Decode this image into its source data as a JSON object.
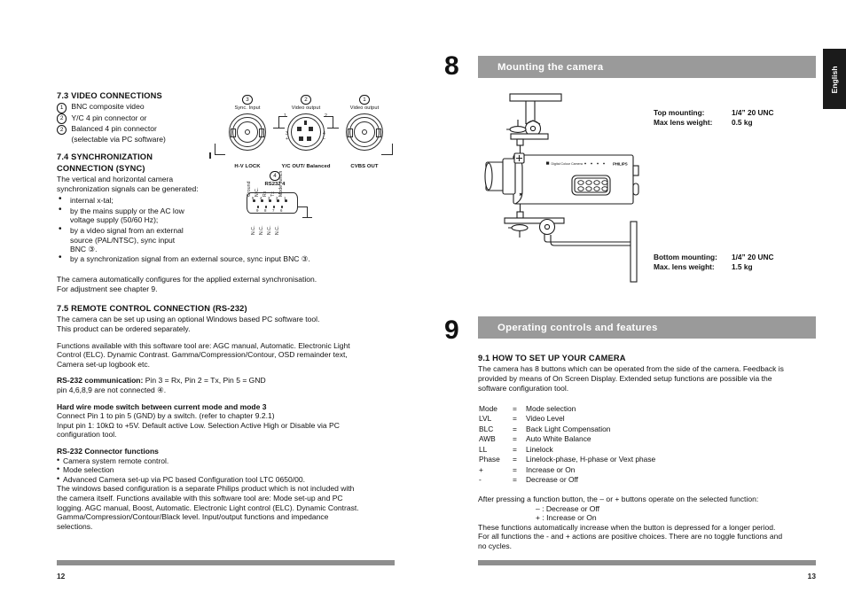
{
  "left_page": {
    "page_number": "12",
    "sections": [
      {
        "id": "video_connections",
        "heading": "7.3  VIDEO CONNECTIONS",
        "items": [
          {
            "num": "1",
            "text": "BNC composite video"
          },
          {
            "num": "2",
            "text": "Y/C 4 pin connector or"
          },
          {
            "num": "2",
            "text": "Balanced 4 pin connector"
          },
          {
            "num": "",
            "text": "(selectable via PC software)"
          }
        ]
      },
      {
        "id": "synchronization",
        "heading_line1": "7.4  SYNCHRONIZATION",
        "heading_line2": "CONNECTION (SYNC)",
        "intro_line1": "The vertical and horizontal camera",
        "intro_line2": "synchronization signals can be generated:",
        "bullets": [
          [
            "internal x-tal;"
          ],
          [
            "by the mains supply or the AC low",
            "voltage supply (50/60 Hz);"
          ],
          [
            "by a video signal from an external",
            "source (PAL/NTSC), sync input",
            "BNC ③."
          ]
        ],
        "bullet_wide": "by a synchronization signal from an external source, sync input BNC ③.",
        "closing_line1": "The camera automatically configures for the applied external synchronisation.",
        "closing_line2": "For adjustment see chapter 9."
      },
      {
        "id": "remote_control",
        "heading": "7.5  REMOTE CONTROL CONNECTION (RS-232)",
        "para1_line1": "The camera can be set up using an optional Windows based PC software tool.",
        "para1_line2": "This product can be ordered separately.",
        "para2_line1": "Functions available with this software tool are: AGC manual, Automatic. Electronic Light",
        "para2_line2": "Control (ELC). Dynamic Contrast. Gamma/Compression/Contour, OSD remainder text,",
        "para2_line3": "Camera set-up logbook etc.",
        "rs232_label": "RS-232 communication:",
        "rs232_value": " Pin 3 = Rx, Pin 2 = Tx, Pin 5 = GND",
        "rs232_line2": "pin 4,6,8,9 are not connected ④.",
        "hardwire_heading": "Hard wire mode switch between current mode and mode 3",
        "hardwire_line1": "Connect Pin 1 to pin 5 (GND) by a switch. (refer to chapter 9.2.1)",
        "hardwire_line2": "Input pin 1: 10kΩ to +5V. Default active Low. Selection Active High or Disable via PC",
        "hardwire_line3": "configuration tool.",
        "connfn_heading": "RS-232 Connector functions",
        "connfn_bullets": [
          "Camera system remote control.",
          "Mode selection",
          "Advanced Camera set-up via PC based Configuration tool LTC 0650/00."
        ],
        "connfn_para": [
          "The windows based configuration is a separate Philips product which is not included with",
          "the camera itself. Functions available with this software tool are: Mode set-up and PC",
          "logging. AGC manual, Boost, Automatic. Electronic Light control (ELC). Dynamic Contrast.",
          "Gamma/Compression/Contour/Black level. Input/output functions and impedance",
          "selections."
        ]
      }
    ],
    "connectors": [
      {
        "num": "3",
        "top_label": "Sync. Input",
        "bottom_label": "H-V LOCK",
        "type": "bnc"
      },
      {
        "num": "2",
        "top_label": "Video output",
        "bottom_label": "Y/C OUT/ Balanced",
        "type": "din4",
        "pin_numbers": [
          "1",
          "2",
          "3",
          "4"
        ],
        "pin_signs": [
          "+",
          "–"
        ]
      },
      {
        "num": "1",
        "top_label": "Video output",
        "bottom_label": "CVBS OUT",
        "type": "bnc"
      }
    ],
    "rs232_connector": {
      "num": "4",
      "title": "RS232 4",
      "top_pin_numbers": [
        "5",
        "4",
        "3",
        "2",
        "1"
      ],
      "top_pin_labels": [
        "Ground",
        "N.C.",
        "Rx",
        "Tx",
        "Mode switch"
      ],
      "bottom_pin_numbers": [
        "9",
        "8",
        "7",
        "6"
      ],
      "bottom_pin_labels": [
        "N.C.",
        "N.C.",
        "N.C.",
        "N.C."
      ]
    }
  },
  "right_page": {
    "page_number": "13",
    "side_tab": "English",
    "chapter8": {
      "number": "8",
      "title": "Mounting the camera",
      "top_spec": {
        "label1": "Top mounting:",
        "value1": "1/4”  20 UNC",
        "label2": "Max lens weight:",
        "value2": "0.5 kg"
      },
      "bottom_spec": {
        "label1": "Bottom mounting:",
        "value1": "1/4”  20 UNC",
        "label2": "Max. lens weight:",
        "value2": "1.5 kg"
      },
      "camera_brand": "PHILIPS",
      "camera_model_text": "Digital Colour Camera"
    },
    "chapter9": {
      "number": "9",
      "title": "Operating controls and features",
      "sub_heading": "9.1  HOW TO SET UP YOUR CAMERA",
      "intro": [
        "The camera has 8 buttons which can be operated from the side of the camera. Feedback is",
        "provided by means of On Screen Display. Extended setup functions are possible via the",
        "software configuration tool."
      ],
      "abbreviations": [
        {
          "key": "Mode",
          "eq": "=",
          "desc": "Mode selection"
        },
        {
          "key": "LVL",
          "eq": "=",
          "desc": "Video Level"
        },
        {
          "key": "BLC",
          "eq": "=",
          "desc": "Back Light Compensation"
        },
        {
          "key": "AWB",
          "eq": "=",
          "desc": "Auto White Balance"
        },
        {
          "key": "LL",
          "eq": "=",
          "desc": "Linelock"
        },
        {
          "key": "Phase",
          "eq": "=",
          "desc": "Linelock-phase, H-phase or Vext phase"
        },
        {
          "key": "+",
          "eq": "=",
          "desc": "Increase  or  On"
        },
        {
          "key": "-",
          "eq": "=",
          "desc": "Decrease or Off"
        }
      ],
      "closing": {
        "line1": "After pressing a function button, the – or + buttons operate on the selected function:",
        "indent1": "–  :  Decrease or Off",
        "indent2": "+  :  Increase or On",
        "line2": "These functions automatically increase when the button is depressed for a longer period.",
        "line3": "For all functions the - and + actions are positive choices. There are no toggle functions and",
        "line4": "no cycles."
      }
    }
  },
  "colors": {
    "bar_gray": "#9a9a9a",
    "rule_gray": "#8e8e8e",
    "tab_black": "#1b1b1b",
    "text": "#111111",
    "line": "#2b2b2b"
  }
}
